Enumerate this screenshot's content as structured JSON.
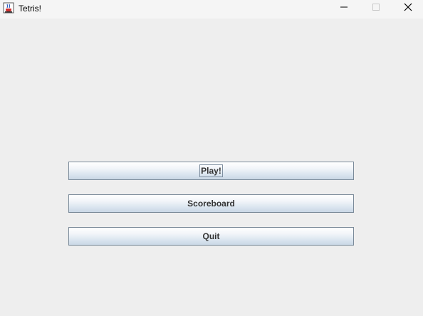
{
  "window": {
    "title": "Tetris!",
    "app_icon": "java-cup-icon",
    "controls": {
      "minimize_icon": "minimize-icon",
      "maximize_icon": "maximize-icon",
      "close_icon": "close-icon"
    }
  },
  "menu": {
    "play_label": "Play!",
    "scoreboard_label": "Scoreboard",
    "quit_label": "Quit",
    "focused_item": "play"
  },
  "colors": {
    "background": "#eeeeee",
    "button_border": "#7a8a99",
    "button_text": "#333333"
  }
}
